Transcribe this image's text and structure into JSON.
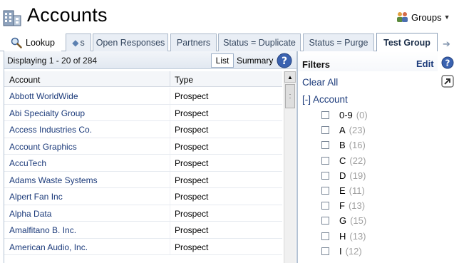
{
  "header": {
    "title": "Accounts",
    "groups_label": "Groups",
    "groups_caret": "▼"
  },
  "tabs": {
    "lookup": "Lookup",
    "back_suffix": "s",
    "items": [
      {
        "label": "Open Responses"
      },
      {
        "label": "Partners"
      },
      {
        "label": "Status = Duplicate"
      },
      {
        "label": "Status = Purge"
      },
      {
        "label": "Test Group",
        "active": true
      }
    ]
  },
  "list_panel": {
    "display_text": "Displaying 1 - 20 of 284",
    "list_button": "List",
    "summary_button": "Summary",
    "columns": [
      "Account",
      "Type"
    ],
    "rows": [
      {
        "account": "Abbott WorldWide",
        "type": "Prospect"
      },
      {
        "account": "Abi Specialty Group",
        "type": "Prospect"
      },
      {
        "account": "Access Industries Co.",
        "type": "Prospect"
      },
      {
        "account": "Account Graphics",
        "type": "Prospect"
      },
      {
        "account": "AccuTech",
        "type": "Prospect"
      },
      {
        "account": "Adams Waste Systems",
        "type": "Prospect"
      },
      {
        "account": "Alpert Fan Inc",
        "type": "Prospect"
      },
      {
        "account": "Alpha Data",
        "type": "Prospect"
      },
      {
        "account": "Amalfitano B. Inc.",
        "type": "Prospect"
      },
      {
        "account": "American Audio, Inc.",
        "type": "Prospect"
      }
    ]
  },
  "filters": {
    "title": "Filters",
    "edit_label": "Edit",
    "clear_all": "Clear All",
    "account_toggle": "[-] Account",
    "items": [
      {
        "label": "0-9",
        "count": "(0)"
      },
      {
        "label": "A",
        "count": "(23)"
      },
      {
        "label": "B",
        "count": "(16)"
      },
      {
        "label": "C",
        "count": "(22)"
      },
      {
        "label": "D",
        "count": "(19)"
      },
      {
        "label": "E",
        "count": "(11)"
      },
      {
        "label": "F",
        "count": "(13)"
      },
      {
        "label": "G",
        "count": "(15)"
      },
      {
        "label": "H",
        "count": "(13)"
      },
      {
        "label": "I",
        "count": "(12)"
      }
    ]
  },
  "colors": {
    "link": "#1b3a7a",
    "tab_text": "#35475f",
    "help_icon": "#3a62b0",
    "count_gray": "#a0a0a0"
  }
}
